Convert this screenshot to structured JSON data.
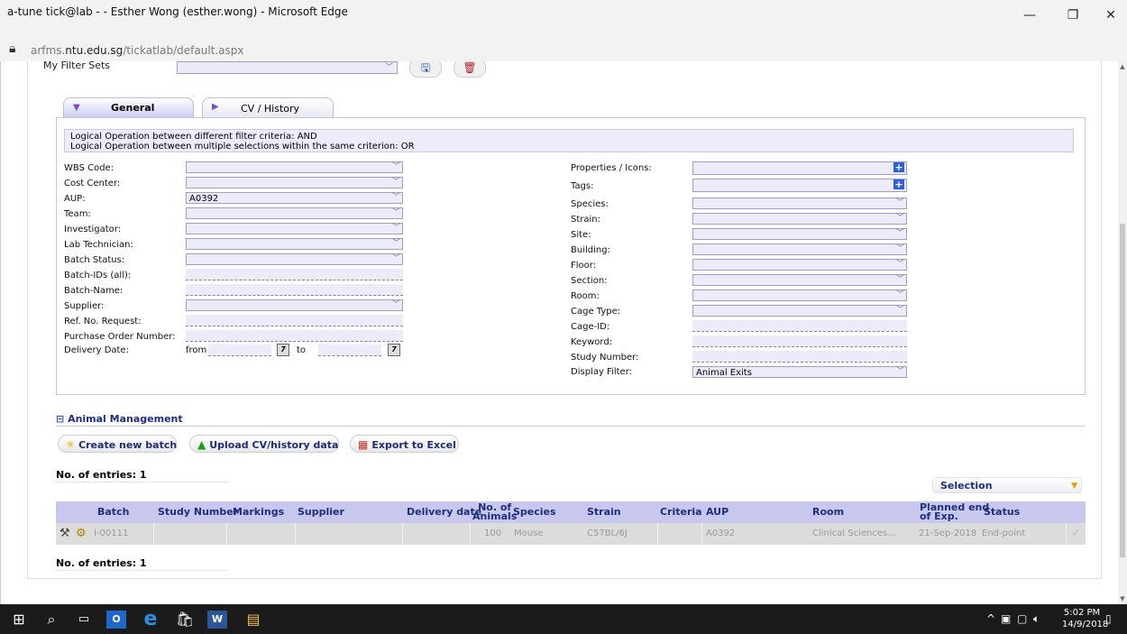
{
  "window": {
    "title": "a-tune tick@lab - - Esther Wong (esther.wong) - Microsoft Edge",
    "minimize": "—",
    "restore": "❐",
    "close": "✕"
  },
  "address": {
    "url_prefix": "arfms.",
    "url_domain": "ntu.edu.sg",
    "url_path": "/tickatlab/default.aspx"
  },
  "filters": {
    "my_filter_sets_label": "My Filter Sets",
    "tabs": {
      "general": "General",
      "cv_history": "CV / History"
    },
    "logic_line1": "Logical Operation between different filter criteria: AND",
    "logic_line2": "Logical Operation between multiple selections within the same criterion: OR",
    "left": {
      "wbs_code": "WBS Code:",
      "cost_center": "Cost Center:",
      "aup": "AUP:",
      "aup_value": "A0392",
      "team": "Team:",
      "investigator": "Investigator:",
      "lab_technician": "Lab Technician:",
      "batch_status": "Batch Status:",
      "batch_ids": "Batch-IDs (all):",
      "batch_name": "Batch-Name:",
      "supplier": "Supplier:",
      "ref_no_request": "Ref. No. Request:",
      "purchase_order_number": "Purchase Order Number:",
      "delivery_date": "Delivery Date:",
      "from": "from",
      "to": "to"
    },
    "right": {
      "properties_icons": "Properties / Icons:",
      "tags": "Tags:",
      "species": "Species:",
      "strain": "Strain:",
      "site": "Site:",
      "building": "Building:",
      "floor": "Floor:",
      "section": "Section:",
      "room": "Room:",
      "cage_type": "Cage Type:",
      "cage_id": "Cage-ID:",
      "keyword": "Keyword:",
      "study_number": "Study Number:",
      "display_filter": "Display Filter:",
      "display_filter_value": "Animal Exits"
    }
  },
  "animal_management": {
    "title": "Animal Management",
    "create_batch": "Create new batch",
    "upload_cv": "Upload CV/history data",
    "export_excel": "Export to Excel",
    "entries_top": "No. of entries: 1",
    "entries_bottom": "No. of entries: 1",
    "selection": "Selection",
    "columns": {
      "batch": "Batch",
      "study_number": "Study Number",
      "markings": "Markings",
      "supplier": "Supplier",
      "delivery_date": "Delivery date",
      "no_of": "No. of",
      "animals": "Animals",
      "species": "Species",
      "strain": "Strain",
      "criteria": "Criteria",
      "aup": "AUP",
      "room": "Room",
      "planned_end": "Planned end",
      "of_exp": "of Exp.",
      "status": "Status"
    },
    "rows": [
      {
        "batch": "I-00111",
        "study_number": "",
        "markings": "",
        "supplier": "",
        "delivery_date": "",
        "no_of_animals": "100",
        "species": "Mouse",
        "strain": "C57BL/6J",
        "criteria": "",
        "aup": "A0392",
        "room": "Clinical Sciences...",
        "planned_end": "21-Sep-2018",
        "status": "End-point"
      }
    ]
  },
  "taskbar": {
    "time": "5:02 PM",
    "date": "14/9/2018"
  }
}
